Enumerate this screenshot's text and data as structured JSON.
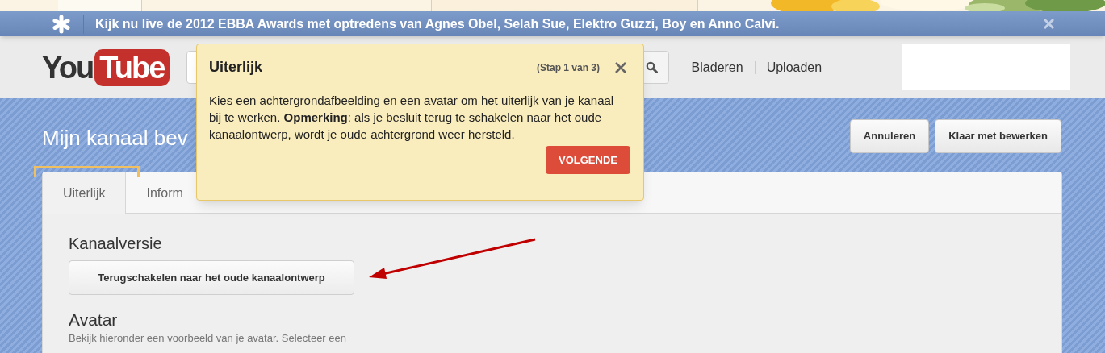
{
  "banner": {
    "text": "Kijk nu live de 2012 EBBA Awards met optredens van Agnes Obel, Selah Sue, Elektro Guzzi, Boy en Anno Calvi."
  },
  "header": {
    "logo": {
      "part1": "You",
      "part2": "Tube"
    },
    "nav_links": [
      "Bladeren",
      "Uploaden"
    ]
  },
  "page_title": "Mijn kanaal bev",
  "header_buttons": [
    "Annuleren",
    "Klaar met bewerken"
  ],
  "tabs": [
    {
      "label": "Uiterlijk",
      "selected": true
    },
    {
      "label": "Inform",
      "selected": false
    }
  ],
  "content": {
    "version_heading": "Kanaalversie",
    "revert_button": "Terugschakelen naar het oude kanaalontwerp",
    "avatar_heading": "Avatar",
    "avatar_text": "Bekijk hieronder een voorbeeld van je avatar. Selecteer een"
  },
  "popover": {
    "title": "Uiterlijk",
    "step": "(Stap 1 van 3)",
    "body": "Kies een achtergrondafbeelding en een avatar om het uiterlijk van je kanaal bij te werken. **Opmerking**: als je besluit terug te schakelen naar het oude kanaalontwerp, wordt je oude achtergrond weer hersteld.",
    "button": "VOLGENDE"
  }
}
